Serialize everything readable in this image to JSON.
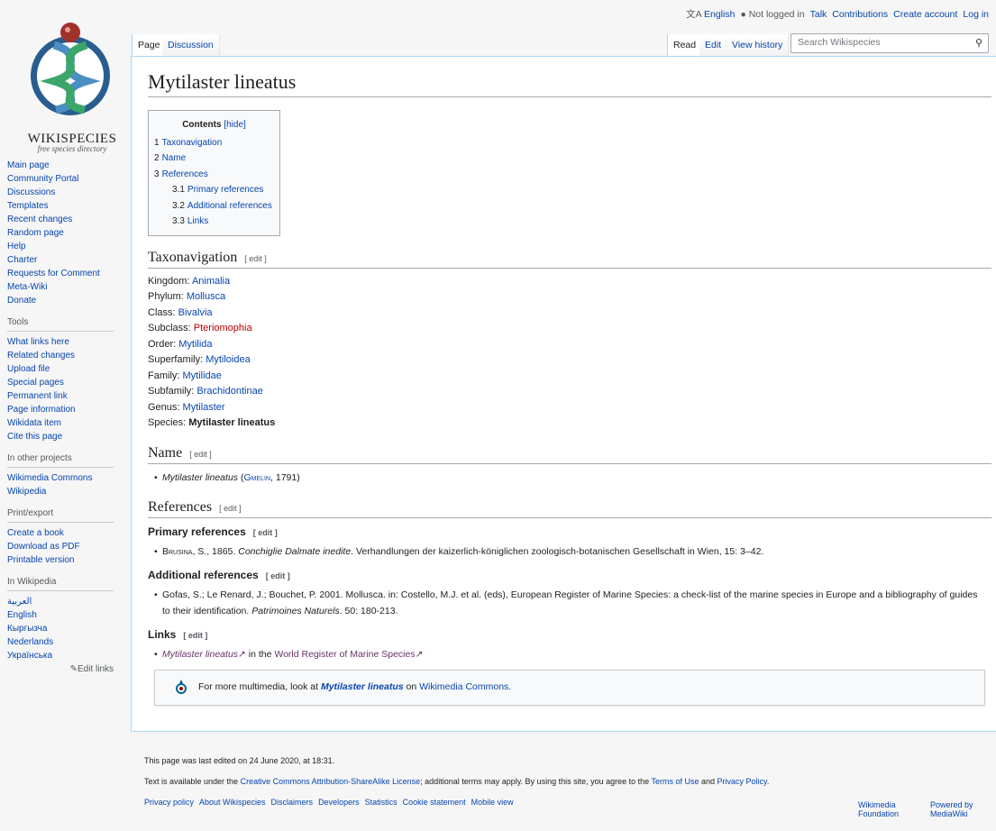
{
  "personal": {
    "language": "English",
    "not_logged_in": "Not logged in",
    "talk": "Talk",
    "contributions": "Contributions",
    "create_account": "Create account",
    "log_in": "Log in"
  },
  "logo": {
    "wordmark": "WIKISPECIES",
    "tagline": "free species directory"
  },
  "tabs": {
    "page": "Page",
    "discussion": "Discussion",
    "read": "Read",
    "edit": "Edit",
    "view_history": "View history"
  },
  "search": {
    "placeholder": "Search Wikispecies"
  },
  "sidebar": {
    "nav": [
      "Main page",
      "Community Portal",
      "Discussions",
      "Templates",
      "Recent changes",
      "Random page",
      "Help",
      "Charter",
      "Requests for Comment",
      "Meta-Wiki",
      "Donate"
    ],
    "tools_title": "Tools",
    "tools": [
      "What links here",
      "Related changes",
      "Upload file",
      "Special pages",
      "Permanent link",
      "Page information",
      "Wikidata item",
      "Cite this page"
    ],
    "other_title": "In other projects",
    "other": [
      "Wikimedia Commons",
      "Wikipedia"
    ],
    "print_title": "Print/export",
    "print": [
      "Create a book",
      "Download as PDF",
      "Printable version"
    ],
    "wiki_title": "In Wikipedia",
    "wiki": [
      "العربية",
      "English",
      "Кыргызча",
      "Nederlands",
      "Українська"
    ],
    "edit_links": "Edit links"
  },
  "page": {
    "title": "Mytilaster lineatus",
    "toc": {
      "title": "Contents",
      "hide": "[hide]",
      "items": [
        {
          "num": "1",
          "label": "Taxonavigation"
        },
        {
          "num": "2",
          "label": "Name"
        },
        {
          "num": "3",
          "label": "References"
        },
        {
          "num": "3.1",
          "label": "Primary references"
        },
        {
          "num": "3.2",
          "label": "Additional references"
        },
        {
          "num": "3.3",
          "label": "Links"
        }
      ]
    },
    "edit_label": "[ edit ]",
    "taxo_heading": "Taxonavigation",
    "taxonomy": [
      {
        "rank": "Kingdom:",
        "name": "Animalia"
      },
      {
        "rank": "Phylum:",
        "name": "Mollusca"
      },
      {
        "rank": "Class:",
        "name": "Bivalvia"
      },
      {
        "rank": "Subclass:",
        "name": "Pteriomophia"
      },
      {
        "rank": "Order:",
        "name": "Mytilida"
      },
      {
        "rank": "Superfamily:",
        "name": "Mytiloidea"
      },
      {
        "rank": "Family:",
        "name": "Mytilidae"
      },
      {
        "rank": "Subfamily:",
        "name": "Brachidontinae"
      },
      {
        "rank": "Genus:",
        "name": "Mytilaster"
      },
      {
        "rank": "Species:",
        "name": "Mytilaster lineatus"
      }
    ],
    "name_heading": "Name",
    "name_italic": "Mytilaster lineatus",
    "name_open": " (",
    "name_author": "Gmelin",
    "name_year": ", 1791)",
    "refs_heading": "References",
    "primary_heading": "Primary references",
    "primary_author": "Brusina",
    "primary_pre": ", S., 1865. ",
    "primary_title": "Conchiglie Dalmate inedite",
    "primary_post": ". Verhandlungen der kaizerlich-königlichen zoologisch-botanischen Gesellschaft in Wien, 15: 3–42.",
    "additional_heading": "Additional references",
    "additional_pre": "Gofas, S.; Le Renard, J.; Bouchet, P. 2001. Mollusca. in: Costello, M.J. et al. (eds), European Register of Marine Species: a check-list of the marine species in Europe and a bibliography of guides to their identification. ",
    "additional_italic": "Patrimoines Naturels",
    "additional_post": ". 50: 180-213.",
    "links_heading": "Links",
    "links_item_link": "Mytilaster lineatus",
    "links_item_mid": " in the ",
    "links_item_worms": "World Register of Marine Species",
    "commons_pre": "For more multimedia, look at ",
    "commons_link": "Mytilaster lineatus",
    "commons_mid": " on ",
    "commons_site": "Wikimedia Commons",
    "commons_post": "."
  },
  "footer": {
    "last_edited": "This page was last edited on 24 June 2020, at 18:31.",
    "license_pre": "Text is available under the ",
    "license_link": "Creative Commons Attribution-ShareAlike License",
    "license_mid": "; additional terms may apply. By using this site, you agree to the ",
    "terms_link": "Terms of Use",
    "and": " and ",
    "privacy_link": "Privacy Policy",
    "period": ".",
    "places": [
      "Privacy policy",
      "About Wikispecies",
      "Disclaimers",
      "Developers",
      "Statistics",
      "Cookie statement",
      "Mobile view"
    ],
    "wikimedia_badge": "Wikimedia Foundation",
    "mediawiki_badge": "Powered by MediaWiki"
  },
  "colors": {
    "link": "#0645ad",
    "redlink": "#ba0000",
    "visited": "#663366",
    "border": "#a7d7f9"
  }
}
